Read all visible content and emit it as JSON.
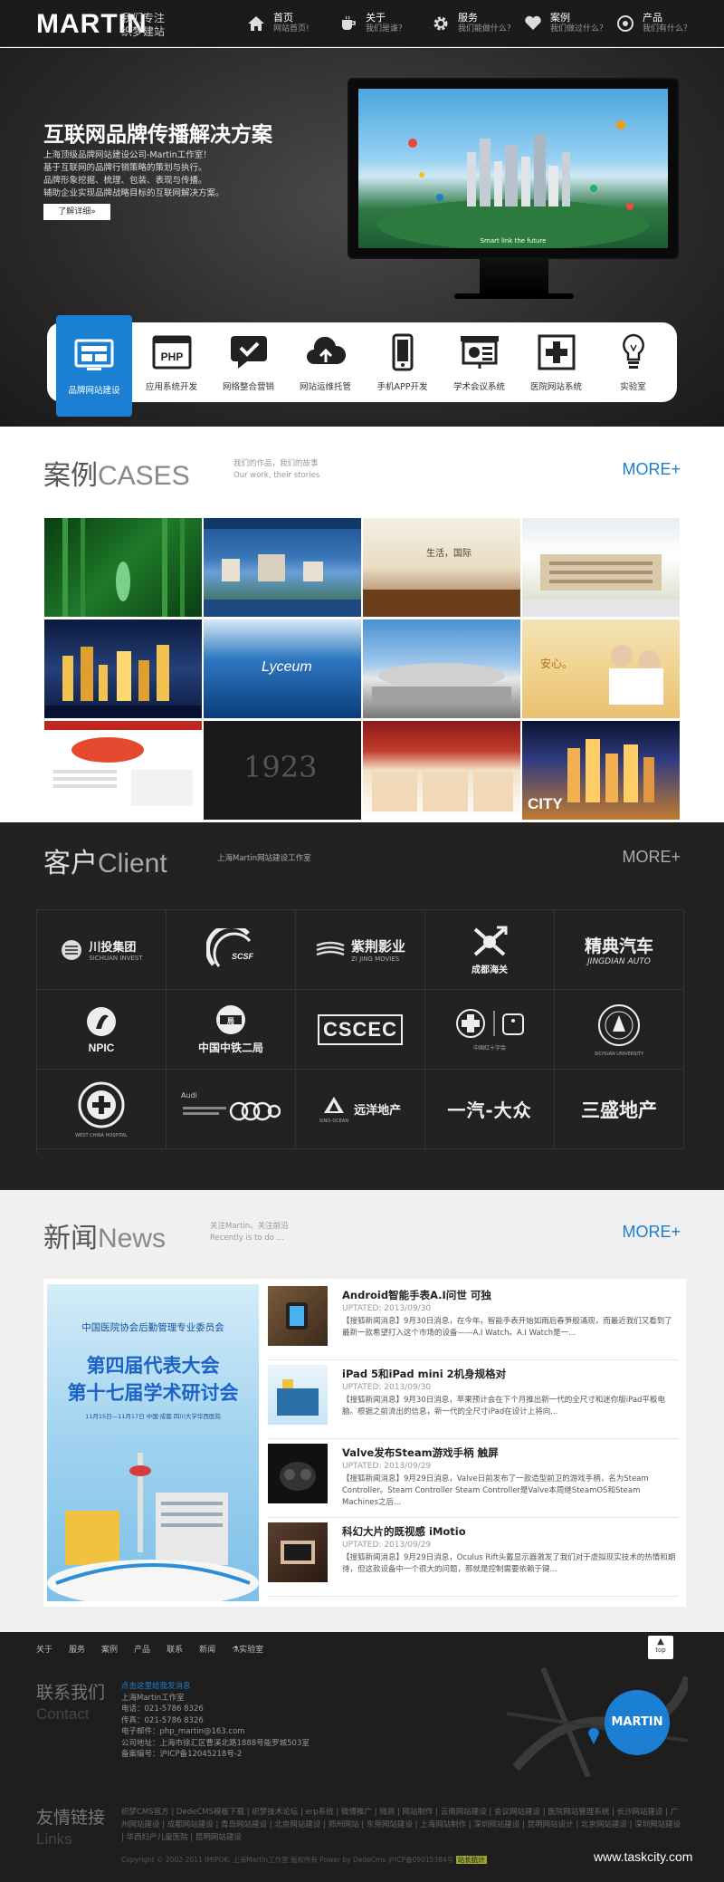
{
  "header": {
    "logo": "MARTIN",
    "slogan_line1": "我们专注",
    "slogan_line2": "织梦建站",
    "nav": [
      {
        "title": "首页",
        "sub": "网站首页!",
        "icon": "home-icon"
      },
      {
        "title": "关于",
        "sub": "我们是谁？",
        "icon": "coffee-icon"
      },
      {
        "title": "服务",
        "sub": "我们能做什么？",
        "icon": "gear-icon"
      },
      {
        "title": "案例",
        "sub": "我们做过什么？",
        "icon": "heart-icon"
      },
      {
        "title": "产品",
        "sub": "我们有什么？",
        "icon": "target-icon"
      }
    ]
  },
  "hero": {
    "title": "互联网品牌传播解决方案",
    "desc": [
      "上海顶级品牌网站建设公司-Martin工作室！",
      "基于互联网的品牌行销策略的策划与执行。",
      "品牌形象挖掘、梳理、包装、表现与传播。",
      "辅助企业实现品牌战略目标的互联网解决方案。"
    ],
    "button": "了解详细»",
    "screen_caption": "Smart link the future"
  },
  "services": [
    {
      "label": "品牌网站建设",
      "icon": "monitor-icon",
      "active": true
    },
    {
      "label": "应用系统开发",
      "icon": "php-icon"
    },
    {
      "label": "网络整合营销",
      "icon": "chat-check-icon"
    },
    {
      "label": "网站运维托管",
      "icon": "cloud-upload-icon"
    },
    {
      "label": "手机APP开发",
      "icon": "mobile-icon"
    },
    {
      "label": "学术会议系统",
      "icon": "presentation-icon"
    },
    {
      "label": "医院网站系统",
      "icon": "medical-cross-icon"
    },
    {
      "label": "实验室",
      "icon": "lightbulb-icon"
    }
  ],
  "cases": {
    "cn": "案例",
    "en": "CASES",
    "sub1": "我们的作品，我们的故事",
    "sub2": "Our work, their stories",
    "more": "MORE+",
    "tiles": [
      {
        "name": "case-bamboo",
        "text": ""
      },
      {
        "name": "case-lake-city",
        "text": ""
      },
      {
        "name": "case-international",
        "text": "生活，国际"
      },
      {
        "name": "case-school",
        "text": ""
      },
      {
        "name": "case-night-city",
        "text": ""
      },
      {
        "name": "case-lyceum",
        "text": "Lyceum"
      },
      {
        "name": "case-expo",
        "text": ""
      },
      {
        "name": "case-family",
        "text": "安心。"
      },
      {
        "name": "case-portal",
        "text": ""
      },
      {
        "name": "case-1923",
        "text": "1923"
      },
      {
        "name": "case-red-portal",
        "text": ""
      },
      {
        "name": "case-city",
        "text": "CITY"
      }
    ]
  },
  "client": {
    "cn": "客户",
    "en": "Client",
    "sub": "上海Martin网站建设工作室",
    "more": "MORE+",
    "logos": [
      {
        "name": "川投集团",
        "en": "SICHUAN INVEST"
      },
      {
        "name": "",
        "en": "SCSF"
      },
      {
        "name": "紫荆影业",
        "en": "ZI JING MOVIES"
      },
      {
        "name": "成都海关",
        "en": ""
      },
      {
        "name": "精典汽车",
        "en": "JINGDIAN AUTO"
      },
      {
        "name": "",
        "en": "NPIC"
      },
      {
        "name": "中国中铁二局",
        "en": ""
      },
      {
        "name": "",
        "en": "CSCEC"
      },
      {
        "name": "",
        "en": "中国红十字会"
      },
      {
        "name": "",
        "en": "SICHUAN UNIVERSITY"
      },
      {
        "name": "",
        "en": "WEST CHINA HOSPITAL"
      },
      {
        "name": "",
        "en": "Audi"
      },
      {
        "name": "远洋地产",
        "en": "SINO-OCEAN"
      },
      {
        "name": "一汽-大众",
        "en": ""
      },
      {
        "name": "三盛地产",
        "en": ""
      }
    ]
  },
  "news": {
    "cn": "新闻",
    "en": "News",
    "sub1": "关注Martin、关注前沿",
    "sub2": "Recently is to do ...",
    "more": "MORE+",
    "poster": {
      "line1": "中国医院协会后勤管理专业委员会",
      "line2": "第四届代表大会",
      "line3": "第十七届学术研讨会",
      "line4": "11月15日—11月17日 中国·成都  四川大学华西医院"
    },
    "items": [
      {
        "title": "Android智能手表A.I问世 可独",
        "date": "UPTATED: 2013/09/30",
        "summary": "【搜狐新闻消息】9月30日消息，在今年，智能手表开始如雨后春笋般涌现，而最近我们又看到了最新一款希望打入这个市场的设备——A.I Watch。A.I Watch是一..."
      },
      {
        "title": "iPad 5和iPad mini 2机身规格对",
        "date": "UPTATED: 2013/09/30",
        "summary": "【搜狐新闻消息】9月30日消息，苹果预计会在下个月推出新一代的全尺寸和迷你版iPad平板电脑。根据之前流出的信息，新一代的全尺寸iPad在设计上将向..."
      },
      {
        "title": "Valve发布Steam游戏手柄 触屏",
        "date": "UPTATED: 2013/09/29",
        "summary": "【搜狐新闻消息】9月29日消息，Valve日前发布了一款造型前卫的游戏手柄，名为Steam Controller。Steam Controller Steam Controller是Valve本周继SteamOS和Steam Machines之后..."
      },
      {
        "title": "科幻大片的既视感 iMotio",
        "date": "UPTATED: 2013/09/29",
        "summary": "【搜狐新闻消息】9月29日消息，Oculus Rift头戴显示器激发了我们对于虚拟现实技术的热情和期待，但这款设备中一个很大的问题，那就是控制需要依赖于键..."
      }
    ]
  },
  "footer": {
    "nav": [
      "关于",
      "服务",
      "案例",
      "产品",
      "联系",
      "新闻",
      "实验室"
    ],
    "top": "top",
    "contact_cn": "联系我们",
    "contact_en": "Contact",
    "contact_lines": [
      "点击这里给我发消息",
      "上海Martin工作室",
      "电话：021-5786 8326",
      "传真：021-5786 8326",
      "电子邮件：php_martin@163.com",
      "公司地址：上海市徐汇区曹溪北路1888号能罗城503室",
      "备案编号：沪ICP备12045218号-2"
    ],
    "map_badge": "MARTIN",
    "links_cn": "友情链接",
    "links_en": "Links",
    "links": "织梦CMS官方 | DedeCMS模板下载 | 织梦技术论坛 | erp系统 | 微博推广 | 微商 | 网站制作 | 云南网站建设 | 会议网站建设 | 医院网站管理系统 | 长沙网站建设 | 广州网站建设 | 成都网站建设 | 青岛网站建设 | 北京网站建设 | 郑州网站 | 东莞网站建设 | 上海网站制作 | 深圳网站建设 | 昆明网站设计 | 北京网站建设 | 深圳网站建设 | 华西妇产儿童医院 | 昆明网站建设",
    "copyright": "Copyright © 2002-2011 IMIPOK. 上海Martin工作室 版权所有 Power by DedeCms 沪ICP备09015384号",
    "copyright_badge": "站长统计",
    "watermark": "www.taskcity.com"
  }
}
